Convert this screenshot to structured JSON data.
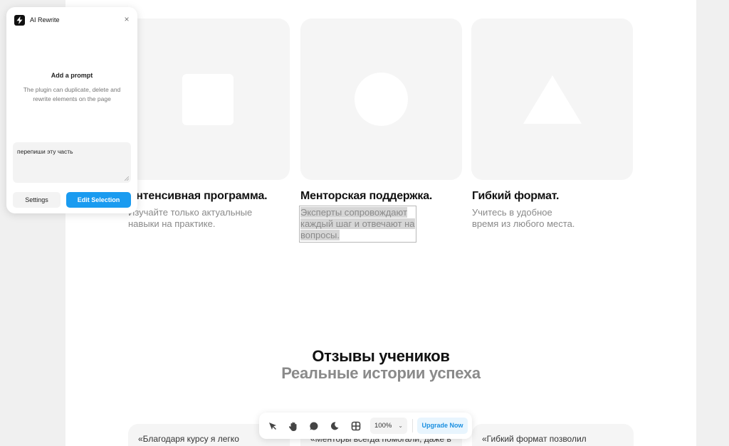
{
  "features": [
    {
      "title": "Интенсивная программа.",
      "line1": "Изучайте только актуальные",
      "line2": "навыки на практике.",
      "shape": "square"
    },
    {
      "title": "Менторская поддержка.",
      "line1": "Эксперты сопровождают",
      "line2": "каждый шаг и отвечают на",
      "line3": "вопросы.",
      "shape": "circle"
    },
    {
      "title": "Гибкий формат.",
      "line1": "Учитесь в удобное",
      "line2": "время из любого места.",
      "shape": "triangle"
    }
  ],
  "reviews_section": {
    "title": "Отзывы учеников",
    "subtitle": "Реальные истории успеха"
  },
  "reviews": [
    {
      "snippet": "«Благодаря курсу я легко"
    },
    {
      "snippet": "«Менторы всегда помогали, даже в"
    },
    {
      "snippet": "«Гибкий формат позволил"
    }
  ],
  "plugin": {
    "app_name": "AI Rewrite",
    "close_icon": "×",
    "heading": "Add a prompt",
    "hint": "The plugin can duplicate, delete and rewrite elements on the page",
    "prompt_value": "перепиши эту часть",
    "settings_label": "Settings",
    "edit_label": "Edit Selection",
    "accent_color": "#1a9bf0"
  },
  "toolbar": {
    "zoom_value": "100%",
    "upgrade_label": "Upgrade Now",
    "tools": [
      "pointer-icon",
      "hand-icon",
      "comment-icon",
      "dark-mode-icon",
      "grid-icon"
    ]
  }
}
